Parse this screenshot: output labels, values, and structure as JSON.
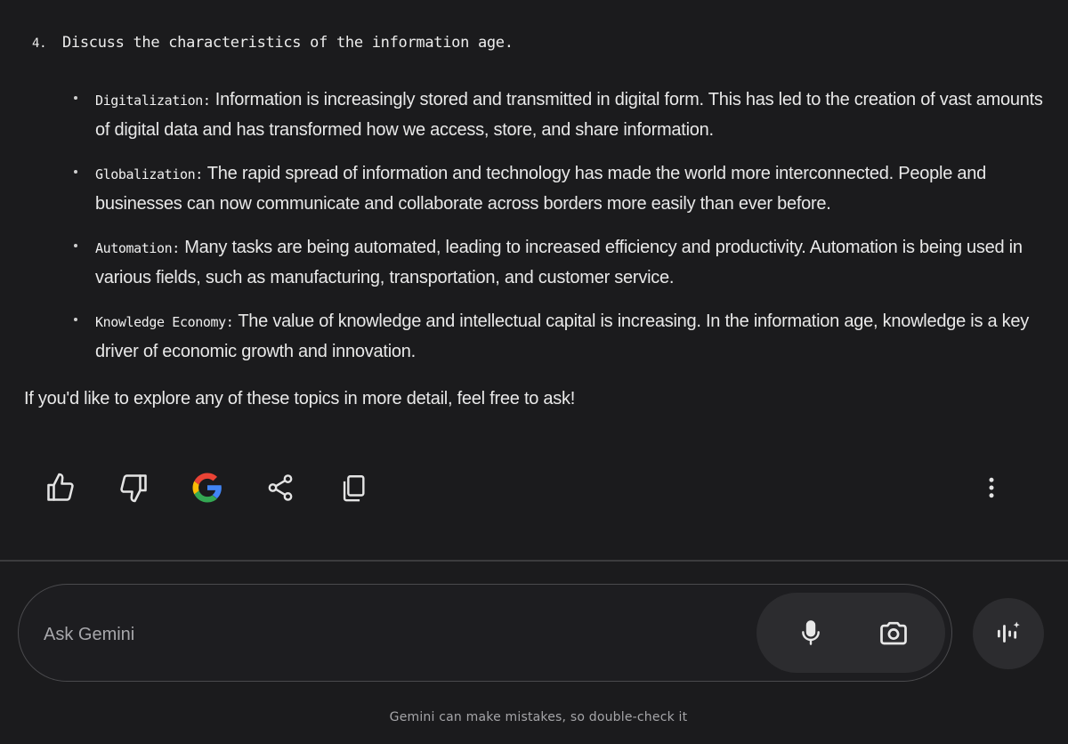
{
  "response": {
    "question_number": "4.",
    "question_text": "Discuss the characteristics of the information age.",
    "bullets": [
      {
        "term": "Digitalization:",
        "text": "Information is increasingly stored and transmitted in digital form. This has led to the creation of vast amounts of digital data and has transformed how we access, store, and share information."
      },
      {
        "term": "Globalization:",
        "text": "The rapid spread of information and technology has made the world more interconnected. People and businesses can now communicate and collaborate across borders more easily than ever before."
      },
      {
        "term": "Automation:",
        "text": "Many tasks are being automated, leading to increased efficiency and productivity. Automation is being used in various fields, such as manufacturing, transportation, and customer service."
      },
      {
        "term": "Knowledge Economy:",
        "text": "The value of knowledge and intellectual capital is increasing. In the information age, knowledge is a key driver of economic growth and innovation."
      }
    ],
    "closing": "If you'd like to explore any of these topics in more detail, feel free to ask!"
  },
  "actions": {
    "icons": [
      "thumbs-up-icon",
      "thumbs-down-icon",
      "google-icon",
      "share-icon",
      "copy-icon",
      "more-vert-icon"
    ]
  },
  "input": {
    "placeholder": "Ask Gemini",
    "value": "",
    "icons": [
      "mic-icon",
      "camera-icon",
      "gemini-live-icon"
    ]
  },
  "footer": {
    "disclaimer": "Gemini can make mistakes, so double-check it"
  },
  "colors": {
    "background": "#1b1b1d",
    "text": "#e6e6e6",
    "muted": "#a5a5a8",
    "pill": "#2c2c2f",
    "google_blue": "#4285F4",
    "google_red": "#EA4335",
    "google_yellow": "#FBBC05",
    "google_green": "#34A853"
  }
}
